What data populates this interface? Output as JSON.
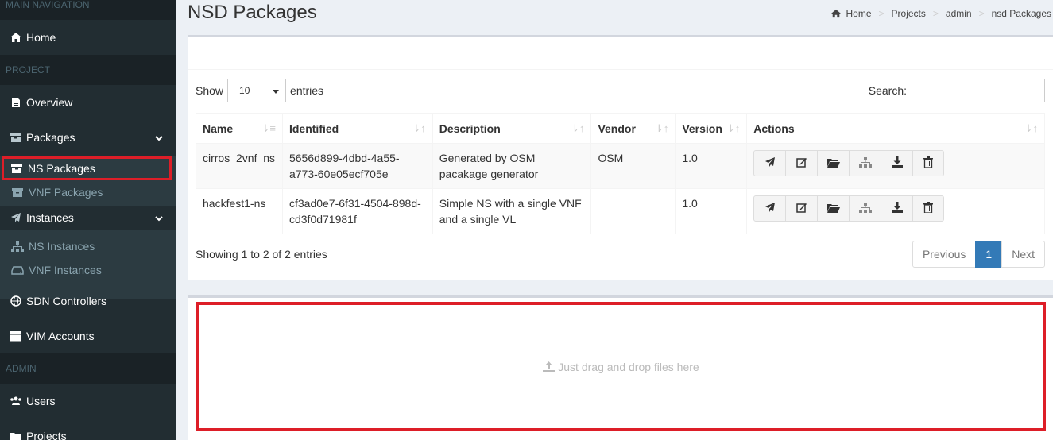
{
  "sidebar": {
    "main_nav_header": "MAIN NAVIGATION",
    "home": "Home",
    "project_header": "PROJECT",
    "overview": "Overview",
    "packages": "Packages",
    "ns_packages": "NS Packages",
    "vnf_packages": "VNF Packages",
    "instances": "Instances",
    "ns_instances": "NS Instances",
    "vnf_instances": "VNF Instances",
    "sdn_controllers": "SDN Controllers",
    "vim_accounts": "VIM Accounts",
    "admin_header": "ADMIN",
    "users": "Users",
    "projects": "Projects"
  },
  "page": {
    "title": "NSD Packages"
  },
  "breadcrumb": {
    "home": "Home",
    "projects": "Projects",
    "admin": "admin",
    "current": "nsd Packages",
    "separator": ">"
  },
  "datatable": {
    "show_label": "Show",
    "entries_label": "entries",
    "page_length": "10",
    "search_label": "Search:",
    "search_value": "",
    "columns": [
      "Name",
      "Identified",
      "Description",
      "Vendor",
      "Version",
      "Actions"
    ],
    "rows": [
      {
        "name": "cirros_2vnf_ns",
        "identified_line1": "5656d899-4dbd-4a55-",
        "identified_line2": "a773-60e05ecf705e",
        "description_line1": "Generated by OSM",
        "description_line2": "pacakage generator",
        "vendor": "OSM",
        "version": "1.0"
      },
      {
        "name": "hackfest1-ns",
        "identified_line1": "cf3ad0e7-6f31-4504-898d-",
        "identified_line2": "cd3f0d71981f",
        "description_line1": "Simple NS with a single VNF",
        "description_line2": "and a single VL",
        "vendor": "",
        "version": "1.0"
      }
    ],
    "info": "Showing 1 to 2 of 2 entries",
    "pager": {
      "previous": "Previous",
      "current": "1",
      "next": "Next"
    }
  },
  "dropzone": {
    "text": "Just drag and drop files here"
  },
  "colors": {
    "sidebar_bg": "#222d32",
    "highlight_red": "#dd1e28",
    "pager_active": "#337ab7"
  }
}
